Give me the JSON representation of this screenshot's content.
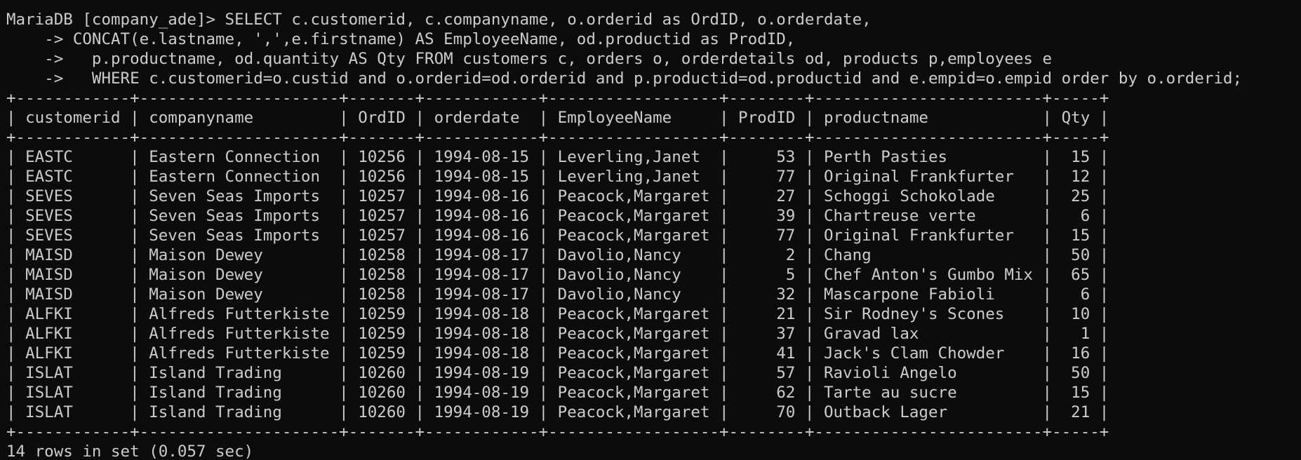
{
  "terminal": {
    "prompt": "MariaDB [company_ade]> ",
    "continuation_prompt": "    -> ",
    "query_lines": [
      "SELECT c.customerid, c.companyname, o.orderid as OrdID, o.orderdate,",
      "CONCAT(e.lastname, ',',e.firstname) AS EmployeeName, od.productid as ProdID,",
      "  p.productname, od.quantity AS Qty FROM customers c, orders o, orderdetails od, products p,employees e",
      "  WHERE c.customerid=o.custid and o.orderid=od.orderid and p.productid=od.productid and e.empid=o.empid order by o.orderid;"
    ],
    "result": {
      "columns": [
        "customerid",
        "companyname",
        "OrdID",
        "orderdate",
        "EmployeeName",
        "ProdID",
        "productname",
        "Qty"
      ],
      "rows": [
        [
          "EASTC",
          "Eastern Connection",
          "10256",
          "1994-08-15",
          "Leverling,Janet",
          "53",
          "Perth Pasties",
          "15"
        ],
        [
          "EASTC",
          "Eastern Connection",
          "10256",
          "1994-08-15",
          "Leverling,Janet",
          "77",
          "Original Frankfurter",
          "12"
        ],
        [
          "SEVES",
          "Seven Seas Imports",
          "10257",
          "1994-08-16",
          "Peacock,Margaret",
          "27",
          "Schoggi Schokolade",
          "25"
        ],
        [
          "SEVES",
          "Seven Seas Imports",
          "10257",
          "1994-08-16",
          "Peacock,Margaret",
          "39",
          "Chartreuse verte",
          "6"
        ],
        [
          "SEVES",
          "Seven Seas Imports",
          "10257",
          "1994-08-16",
          "Peacock,Margaret",
          "77",
          "Original Frankfurter",
          "15"
        ],
        [
          "MAISD",
          "Maison Dewey",
          "10258",
          "1994-08-17",
          "Davolio,Nancy",
          "2",
          "Chang",
          "50"
        ],
        [
          "MAISD",
          "Maison Dewey",
          "10258",
          "1994-08-17",
          "Davolio,Nancy",
          "5",
          "Chef Anton's Gumbo Mix",
          "65"
        ],
        [
          "MAISD",
          "Maison Dewey",
          "10258",
          "1994-08-17",
          "Davolio,Nancy",
          "32",
          "Mascarpone Fabioli",
          "6"
        ],
        [
          "ALFKI",
          "Alfreds Futterkiste",
          "10259",
          "1994-08-18",
          "Peacock,Margaret",
          "21",
          "Sir Rodney's Scones",
          "10"
        ],
        [
          "ALFKI",
          "Alfreds Futterkiste",
          "10259",
          "1994-08-18",
          "Peacock,Margaret",
          "37",
          "Gravad lax",
          "1"
        ],
        [
          "ALFKI",
          "Alfreds Futterkiste",
          "10259",
          "1994-08-18",
          "Peacock,Margaret",
          "41",
          "Jack's Clam Chowder",
          "16"
        ],
        [
          "ISLAT",
          "Island Trading",
          "10260",
          "1994-08-19",
          "Peacock,Margaret",
          "57",
          "Ravioli Angelo",
          "50"
        ],
        [
          "ISLAT",
          "Island Trading",
          "10260",
          "1994-08-19",
          "Peacock,Margaret",
          "62",
          "Tarte au sucre",
          "15"
        ],
        [
          "ISLAT",
          "Island Trading",
          "10260",
          "1994-08-19",
          "Peacock,Margaret",
          "70",
          "Outback Lager",
          "21"
        ]
      ],
      "numeric_columns": [
        2,
        5,
        7
      ]
    },
    "footer": "14 rows in set (0.057 sec)",
    "colors": {
      "background": "#0c0c0c",
      "foreground": "#cccccc"
    }
  }
}
